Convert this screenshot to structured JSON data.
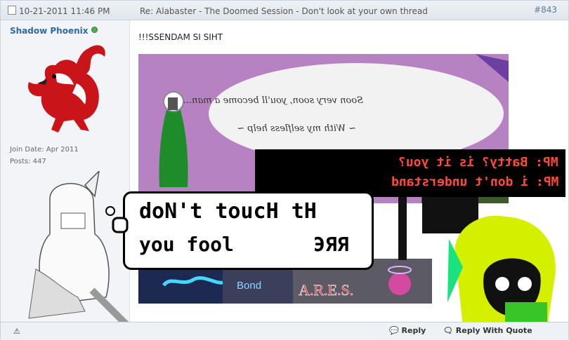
{
  "post": {
    "date": "10-21-2011 11:46 PM",
    "title": "Re: Alabaster - The Doomed Session - Don't look at your own thread",
    "number": "#843"
  },
  "author": {
    "name": "Shadow Phoenix",
    "join_date": "Join Date: Apr 2011",
    "posts": "Posts: 447"
  },
  "message": {
    "text": "!!!SSENDAM SI SIHT"
  },
  "image": {
    "script_line1": "Soon very soon, you'll become a man...",
    "script_line2": "~ With my selfless help ~",
    "dialog_line1": "MP: Batty? is it you?",
    "dialog_line2": "MP: i don't understand",
    "bubble_line1": "doN't toucH tH",
    "bubble_line2": "you fool",
    "bubble_line3": "ЭЯЯ",
    "strip_bond": "Bond",
    "strip_ares": "A.R.E.S."
  },
  "footer": {
    "reply": "Reply",
    "reply_quote": "Reply With Quote"
  },
  "colors": {
    "link": "#2d6ba7",
    "header_bg": "#dfe5ec",
    "dialog_text": "#ff4a3a"
  }
}
